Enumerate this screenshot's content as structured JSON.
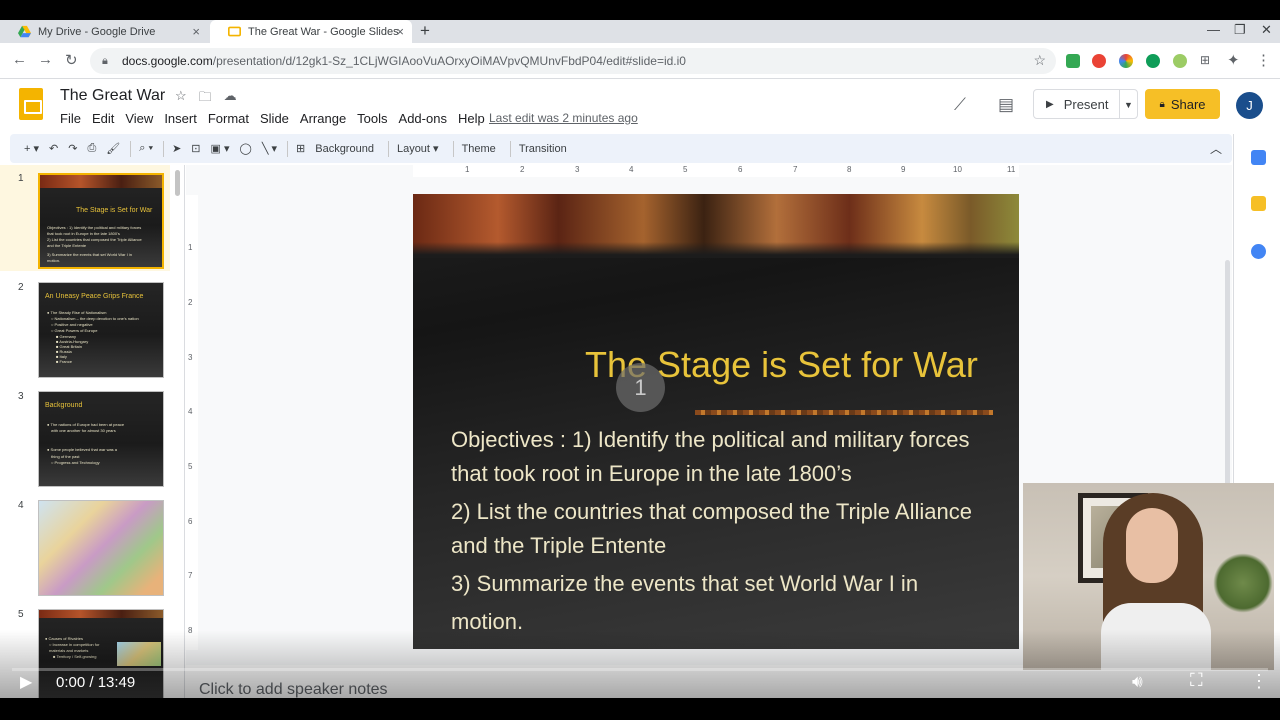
{
  "browser": {
    "tabs": [
      {
        "label": "My Drive - Google Drive",
        "close": "×"
      },
      {
        "label": "The Great War - Google Slides",
        "close": "×"
      }
    ],
    "new_tab": "+",
    "url_host": "docs.google.com",
    "url_path": "/presentation/d/12gk1-Sz_1CLjWGIAooVuAOrxyOiMAVpvQMUnvFbdP04/edit#slide=id.i0"
  },
  "header": {
    "doc_title": "The Great War",
    "menus": [
      "File",
      "Edit",
      "View",
      "Insert",
      "Format",
      "Slide",
      "Arrange",
      "Tools",
      "Add-ons",
      "Help"
    ],
    "last_edit": "Last edit was 2 minutes ago",
    "present_label": "Present",
    "share_label": "Share",
    "avatar_initial": "J"
  },
  "toolbar": {
    "background": "Background",
    "layout": "Layout",
    "theme": "Theme",
    "transition": "Transition"
  },
  "ruler": {
    "h_ticks": [
      "1",
      "2",
      "3",
      "4",
      "5",
      "6",
      "7",
      "8",
      "9",
      "10",
      "11"
    ],
    "v_ticks": [
      "1",
      "2",
      "3",
      "4",
      "5",
      "6",
      "7",
      "8"
    ]
  },
  "filmstrip": [
    {
      "num": "1",
      "title": "The Stage is Set for War",
      "lines": [
        "Objectives : 1) Identify the political and military forces",
        "that took root in Europe in the late 1800's",
        "2) List the countries that composed the Triple Alliance",
        "and the Triple Entente",
        "3) Summarize the events that set World War I in",
        "motion."
      ]
    },
    {
      "num": "2",
      "title": "An Uneasy Peace Grips France",
      "lines": [
        "● The Steady Rise of Nationalism",
        "○ Nationalism – the deep devotion to one's nation",
        "○ Positive and negative",
        "○ Great Powers of Europe",
        "■ Germany",
        "■ Austria-Hungary",
        "■ Great Britain",
        "■ Russia",
        "■ Italy",
        "■ France"
      ]
    },
    {
      "num": "3",
      "title": "Background",
      "lines": [
        "● The nations of Europe had been at peace",
        "with one another for almost 30 years",
        "",
        "● Some people believed that war was a",
        "thing of the past",
        "○ Progress and Technology"
      ]
    },
    {
      "num": "4",
      "title": "",
      "lines": []
    },
    {
      "num": "5",
      "title": "",
      "lines": [
        "● Causes of Rivalries",
        "○ Increase in competition for",
        "materials and markets",
        "■ Territory / Self-growing"
      ]
    }
  ],
  "slide": {
    "title": "The Stage is Set for War",
    "lines": [
      "Objectives : 1) Identify the political and military forces",
      "that took root in Europe in the late 1800’s",
      "2) List the countries that composed the Triple Alliance",
      "and the Triple Entente",
      "3) Summarize the events that set World War I in",
      "motion."
    ],
    "badge": "1",
    "title_color": "#e8c33a",
    "body_color": "#ede6c7"
  },
  "notes": {
    "placeholder": "Click to add speaker notes"
  },
  "player": {
    "time": "0:00 / 13:49"
  }
}
